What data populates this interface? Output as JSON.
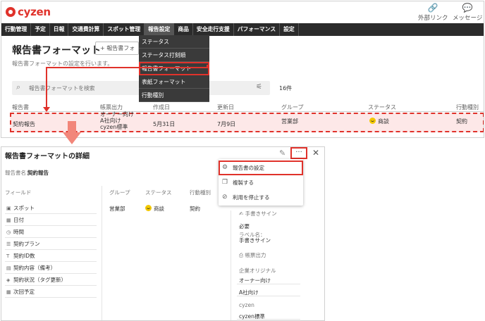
{
  "app": {
    "logo": "cyzen"
  },
  "header": {
    "links": [
      {
        "label": "外部リンク",
        "icon": "link-icon"
      },
      {
        "label": "メッセージ",
        "icon": "message-icon"
      }
    ]
  },
  "nav": {
    "items": [
      "行動管理",
      "予定",
      "日報",
      "交通費計算",
      "スポット管理",
      "報告設定",
      "商品",
      "安全走行支援",
      "パフォーマンス",
      "設定"
    ],
    "active_index": 5
  },
  "dropdown": {
    "items": [
      "ステータス",
      "ステータス打刻順",
      "報告書フォーマット",
      "表紙フォーマット",
      "行動種別"
    ],
    "highlight_index": 2
  },
  "page": {
    "title": "報告書フォーマット",
    "add_button": "+ 報告書フォ",
    "subtitle": "報告書フォーマットの設定を行います。",
    "search_placeholder": "報告書フォーマットを検索",
    "count": "16件"
  },
  "table": {
    "columns": [
      "報告書",
      "帳票出力",
      "作成日",
      "更新日",
      "グループ",
      "ステータス",
      "行動種別"
    ],
    "row": {
      "name": "契約報告",
      "output": [
        "オーナー向け",
        "A社向け",
        "cyzen標準"
      ],
      "created": "5月31日",
      "updated": "7月9日",
      "group": "営業部",
      "status": "商談",
      "action_type": "契約"
    }
  },
  "detail": {
    "title": "報告書フォーマットの詳細",
    "name_label": "報告書名：",
    "name_value": "契約報告",
    "columns": [
      "フィールド",
      "グループ",
      "ステータス",
      "行動種別"
    ],
    "group": "営業部",
    "status": "商談",
    "action_type": "契約",
    "fields": [
      {
        "label": "スポット",
        "icon": "spot-icon"
      },
      {
        "label": "日付",
        "icon": "calendar-icon"
      },
      {
        "label": "時間",
        "icon": "clock-icon"
      },
      {
        "label": "契約プラン",
        "icon": "list-icon"
      },
      {
        "label": "契約ID数",
        "icon": "text-icon"
      },
      {
        "label": "契約内容（備考）",
        "icon": "textarea-icon"
      },
      {
        "label": "契約状況（タグ更新）",
        "icon": "tag-icon"
      },
      {
        "label": "次回予定",
        "icon": "calendar-icon"
      }
    ],
    "side": {
      "signature_label": "手書きサイン",
      "required": "必要",
      "label_name_caption": "ラベル名：",
      "label_name": "手書きサイン",
      "output_label": "帳票出力",
      "company_original": "企業オリジナル",
      "owner": "オーナー向け",
      "a_company": "A社向け",
      "cyzen": "cyzen",
      "cyzen_standard": "cyzen標準"
    }
  },
  "menu": {
    "items": [
      {
        "label": "報告書の設定",
        "icon": "gear-icon"
      },
      {
        "label": "複製する",
        "icon": "copy-icon"
      },
      {
        "label": "利用を停止する",
        "icon": "stop-icon"
      }
    ]
  },
  "colors": {
    "accent": "#e0322b",
    "nav_bg": "#2b2b2b",
    "row_highlight": "#fde8e8",
    "status_badge": "#f3c800"
  }
}
